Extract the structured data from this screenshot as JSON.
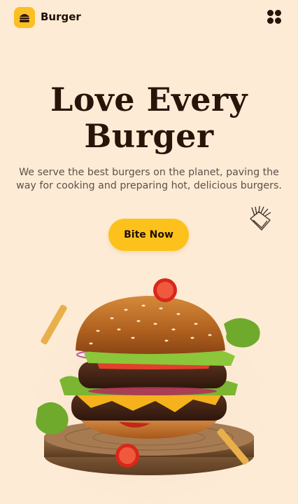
{
  "header": {
    "brand": "Burger",
    "logo_icon": "burger-logo-icon",
    "menu_icon": "grid-menu-icon"
  },
  "hero": {
    "title_line1": "Love Every",
    "title_line2": "Burger",
    "subtitle": "We serve the best burgers on the planet, paving the way for cooking and preparing hot, delicious burgers.",
    "cta_label": "Bite Now"
  },
  "decor": {
    "fries_icon": "fries-icon",
    "hero_image": "burger-image"
  },
  "colors": {
    "background": "#fdebd6",
    "accent": "#fcc21b",
    "text": "#2a1308"
  }
}
